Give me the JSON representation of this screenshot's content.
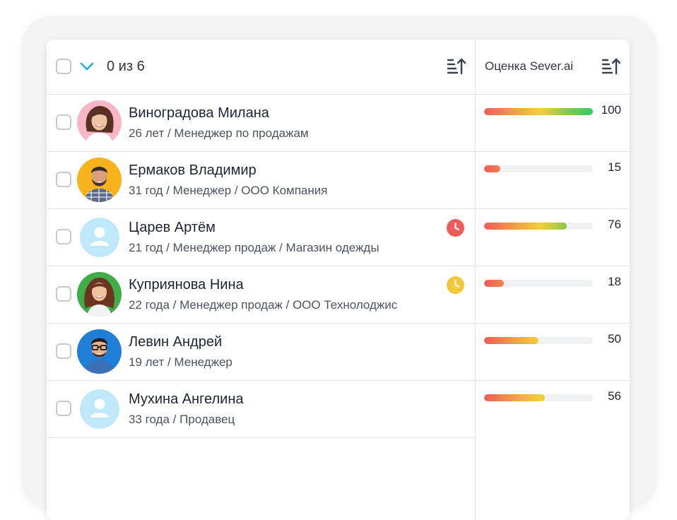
{
  "header": {
    "selection_count": "0 из 6",
    "score_column_title": "Оценка Sever.ai"
  },
  "colors": {
    "accent": "#2aa8e8",
    "clock_red": "#ef5b58",
    "clock_yellow": "#f2c83a",
    "placeholder_avatar_bg": "#bfe8fb"
  },
  "candidates": [
    {
      "name": "Виноградова Милана",
      "details": "26 лет / Менеджер по продажам",
      "score": 100,
      "score_label": "100",
      "avatar": "photo",
      "clock": null
    },
    {
      "name": "Ермаков Владимир",
      "details": "31 год / Менеджер / ООО Компания",
      "score": 15,
      "score_label": "15",
      "avatar": "photo",
      "clock": null
    },
    {
      "name": "Царев Артём",
      "details": "21 год / Менеджер продаж / Магазин одежды",
      "score": 76,
      "score_label": "76",
      "avatar": "placeholder",
      "clock": "red-clock-icon"
    },
    {
      "name": "Куприянова Нина",
      "details": "22 года / Менеджер продаж / ООО Технолоджис",
      "score": 18,
      "score_label": "18",
      "avatar": "photo",
      "clock": "yellow-clock-icon"
    },
    {
      "name": "Левин Андрей",
      "details": "19 лет / Менеджер",
      "score": 50,
      "score_label": "50",
      "avatar": "photo",
      "clock": null
    },
    {
      "name": "Мухина Ангелина",
      "details": "33 года / Продавец",
      "score": 56,
      "score_label": "56",
      "avatar": "placeholder",
      "clock": null
    }
  ]
}
